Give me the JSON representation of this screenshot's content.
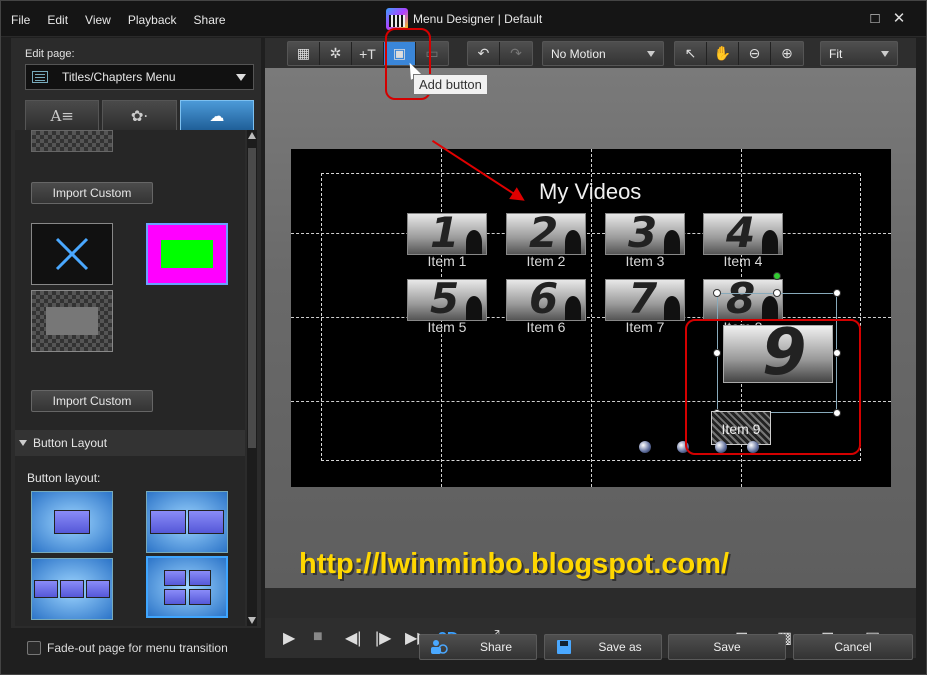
{
  "window": {
    "title": "Menu Designer | Default"
  },
  "menu": [
    "File",
    "Edit",
    "View",
    "Playback",
    "Share"
  ],
  "left": {
    "edit_page_label": "Edit page:",
    "page_select": "Titles/Chapters Menu",
    "import_custom_1": "Import Custom",
    "import_custom_2": "Import Custom",
    "button_layout_section": "Button Layout",
    "button_layout_label": "Button layout:"
  },
  "toolbar": {
    "motion_select": "No Motion",
    "zoom_select": "Fit",
    "tooltip": "Add button"
  },
  "stage": {
    "title": "My Videos",
    "items": [
      {
        "num": "1",
        "label": "Item 1"
      },
      {
        "num": "2",
        "label": "Item 2"
      },
      {
        "num": "3",
        "label": "Item 3"
      },
      {
        "num": "4",
        "label": "Item 4"
      },
      {
        "num": "5",
        "label": "Item 5"
      },
      {
        "num": "6",
        "label": "Item 6"
      },
      {
        "num": "7",
        "label": "Item 7"
      },
      {
        "num": "8",
        "label": "Item 8"
      }
    ],
    "item9_num": "9",
    "item9_label": "Item 9"
  },
  "watermark_url": "http://lwinminbo.blogspot.com/",
  "playbar": {
    "three_d": "3D"
  },
  "bottom": {
    "fadeout": "Fade-out page for menu transition",
    "share": "Share",
    "save_as": "Save as",
    "save": "Save",
    "cancel": "Cancel"
  },
  "colors": {
    "accent": "#3a86d9",
    "highlight": "#d40000",
    "url": "#ffd700"
  }
}
